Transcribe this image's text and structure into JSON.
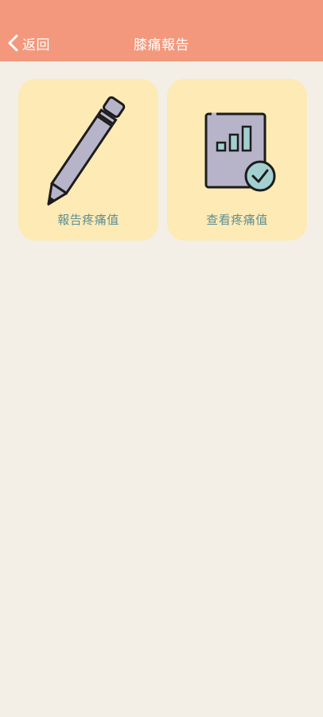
{
  "header": {
    "back_label": "返回",
    "title": "膝痛報告",
    "background": "#f3987c"
  },
  "cards": [
    {
      "label": "報告疼痛值",
      "icon": "pencil-icon"
    },
    {
      "label": "查看疼痛值",
      "icon": "chart-check-icon"
    }
  ],
  "colors": {
    "page_background": "#f3efe6",
    "card_background": "#fdeab4",
    "label_color": "#5e8e96",
    "icon_fill": "#b7b3c9",
    "check_fill": "#a4cfd1"
  }
}
